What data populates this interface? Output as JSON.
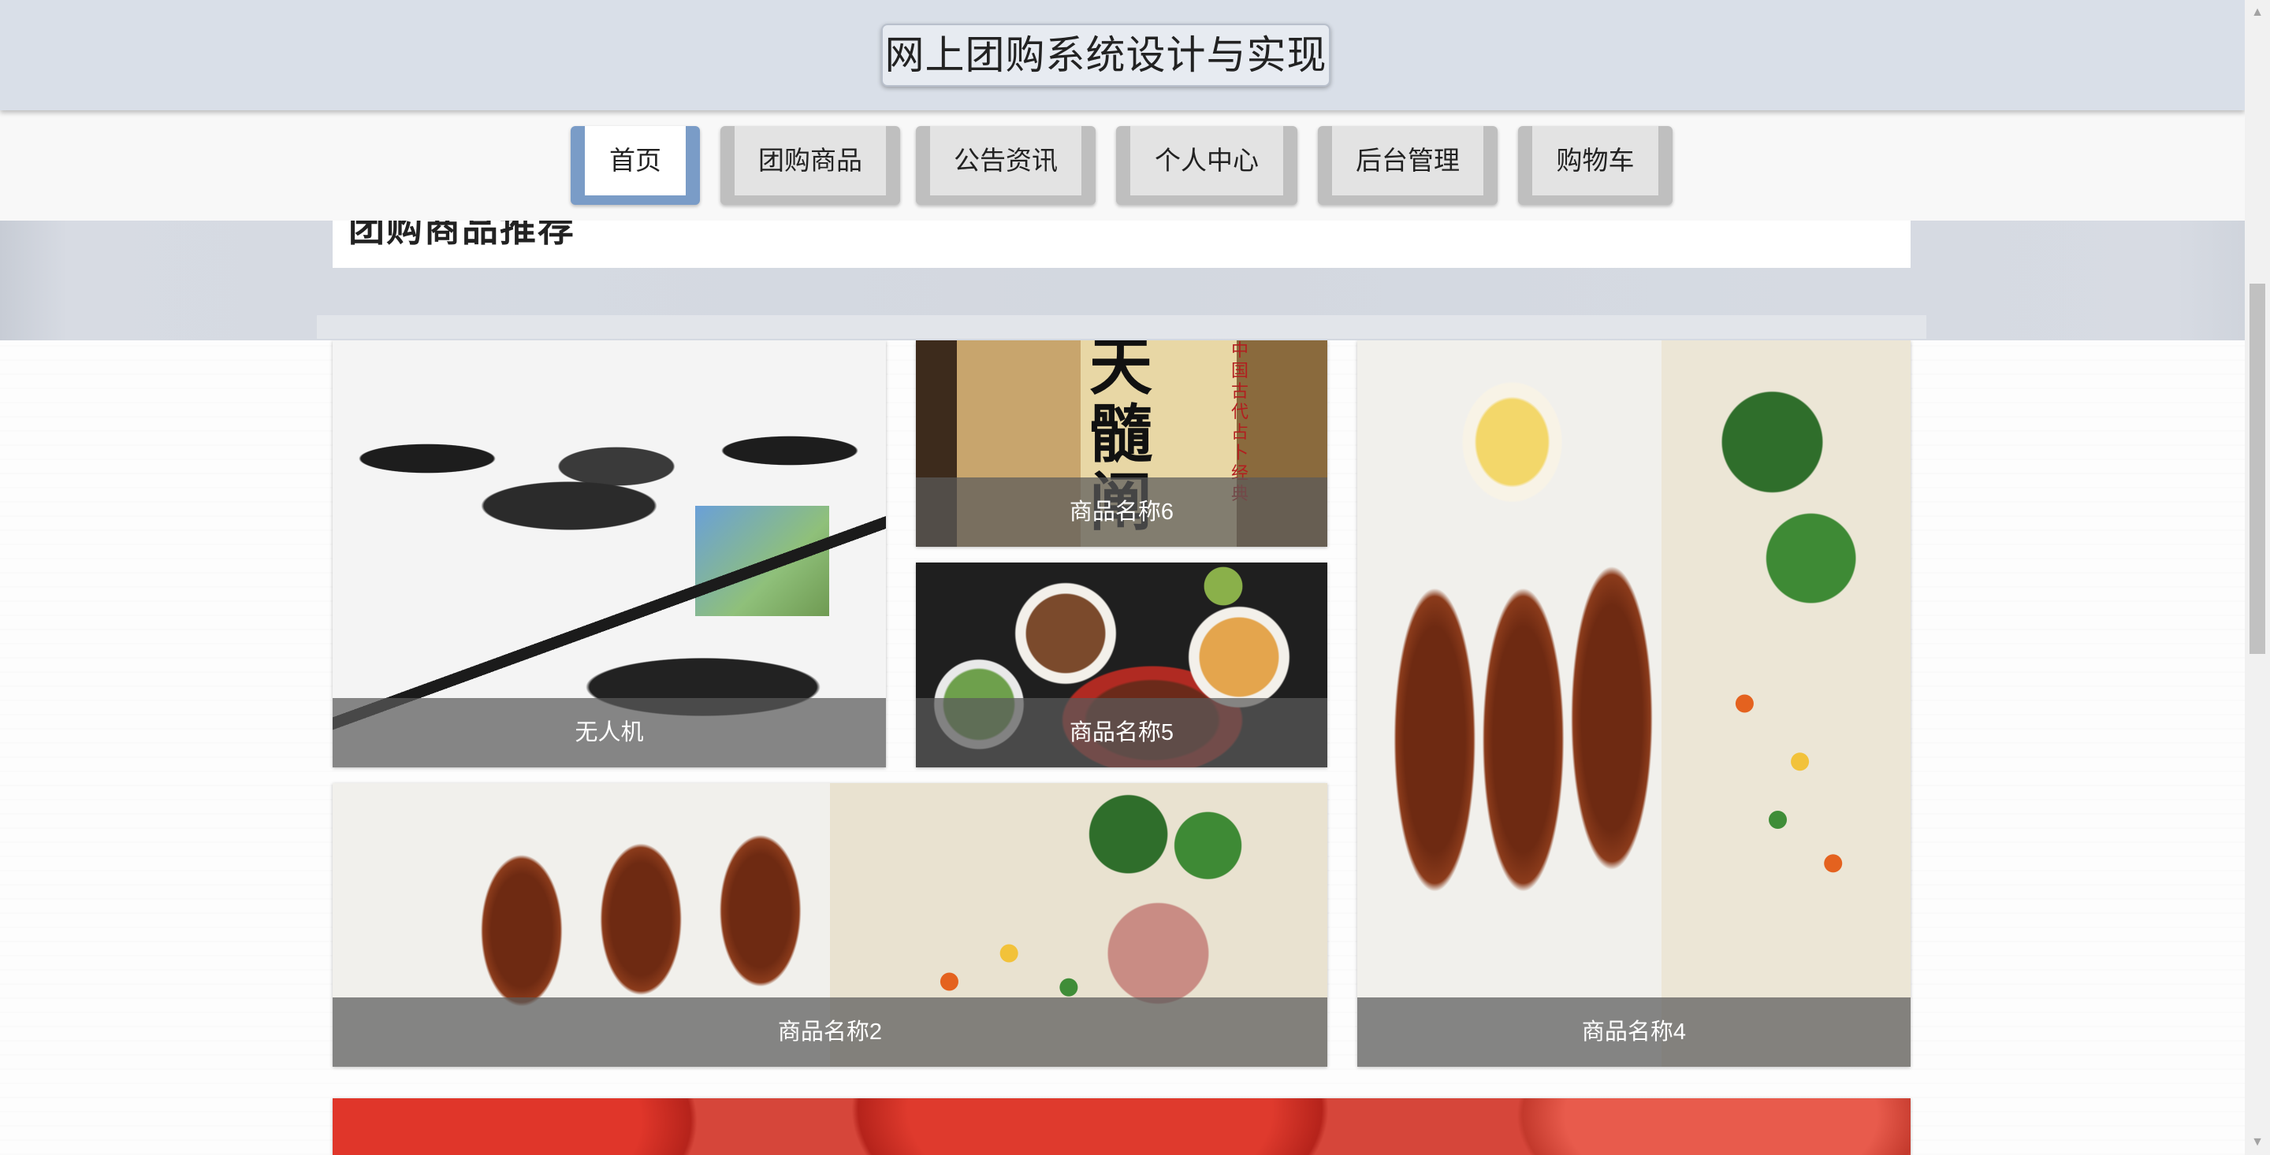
{
  "header": {
    "title": "网上团购系统设计与实现"
  },
  "nav": {
    "items": [
      {
        "label": "首页",
        "active": true
      },
      {
        "label": "团购商品",
        "active": false
      },
      {
        "label": "公告资讯",
        "active": false
      },
      {
        "label": "个人中心",
        "active": false
      },
      {
        "label": "后台管理",
        "active": false
      },
      {
        "label": "购物车",
        "active": false
      }
    ]
  },
  "section": {
    "heading": "团购商品推荐"
  },
  "products": [
    {
      "name": "无人机",
      "image": "drone-image"
    },
    {
      "name": "商品名称6",
      "image": "book-image"
    },
    {
      "name": "商品名称5",
      "image": "bowls-image"
    },
    {
      "name": "商品名称4",
      "image": "bento-image"
    },
    {
      "name": "商品名称2",
      "image": "bento-image"
    },
    {
      "name": "",
      "image": "tomato-image"
    }
  ],
  "book_art": {
    "glyphs": "天髓阐",
    "red_text": "中国古代占卜经典"
  },
  "colors": {
    "header_bg": "#d9dfe8",
    "nav_active_border": "#7a9cc7",
    "nav_button": "#e3e3e3",
    "caption_overlay": "rgba(90,90,90,0.72)"
  }
}
